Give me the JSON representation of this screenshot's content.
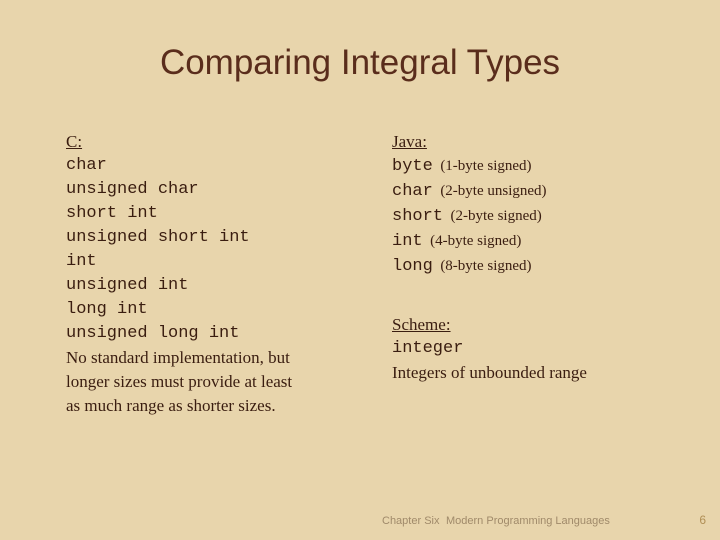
{
  "slide": {
    "title": "Comparing Integral Types",
    "left_column": {
      "heading": "C:",
      "code_lines": [
        "char",
        "unsigned char",
        "short int",
        "unsigned short int",
        "int",
        "unsigned int",
        "long int",
        "unsigned long int"
      ],
      "note_lines": [
        "No standard implementation, but",
        "longer sizes must provide at least",
        "as much range as shorter sizes."
      ]
    },
    "right_column": {
      "java_heading": "Java:",
      "java_types": [
        {
          "name": "byte",
          "annotation": "(1-byte signed)"
        },
        {
          "name": "char",
          "annotation": "(2-byte unsigned)"
        },
        {
          "name": "short",
          "annotation": "(2-byte signed)"
        },
        {
          "name": "int",
          "annotation": "(4-byte signed)"
        },
        {
          "name": "long",
          "annotation": "(8-byte signed)"
        }
      ],
      "scheme_heading": "Scheme:",
      "scheme_type": "integer",
      "scheme_note": "Integers of unbounded range"
    }
  },
  "footer": {
    "chapter": "Chapter Six",
    "book": "Modern Programming Languages",
    "page": "6"
  },
  "colors": {
    "background": "#e8d5ac",
    "title": "#5a2d1c",
    "body_text": "#3a1d10",
    "footer_text": "#a08a6a",
    "page_number": "#b08f55"
  }
}
